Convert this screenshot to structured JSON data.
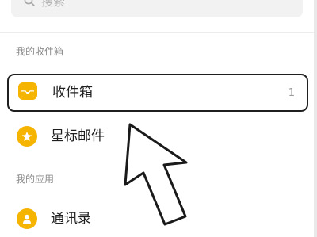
{
  "search": {
    "placeholder": "搜索",
    "icon": "search-icon"
  },
  "sections": {
    "mailboxes_title": "我的收件箱",
    "apps_title": "我的应用"
  },
  "mailboxes": [
    {
      "label": "收件箱",
      "count": "1",
      "icon": "inbox-icon",
      "selected": true
    },
    {
      "label": "星标邮件",
      "icon": "star-icon",
      "selected": false
    }
  ],
  "apps": [
    {
      "label": "通讯录",
      "icon": "contacts-icon"
    }
  ],
  "colors": {
    "accent": "#f4b400",
    "text": "#1f1f1f",
    "muted": "#8a8a8a"
  }
}
